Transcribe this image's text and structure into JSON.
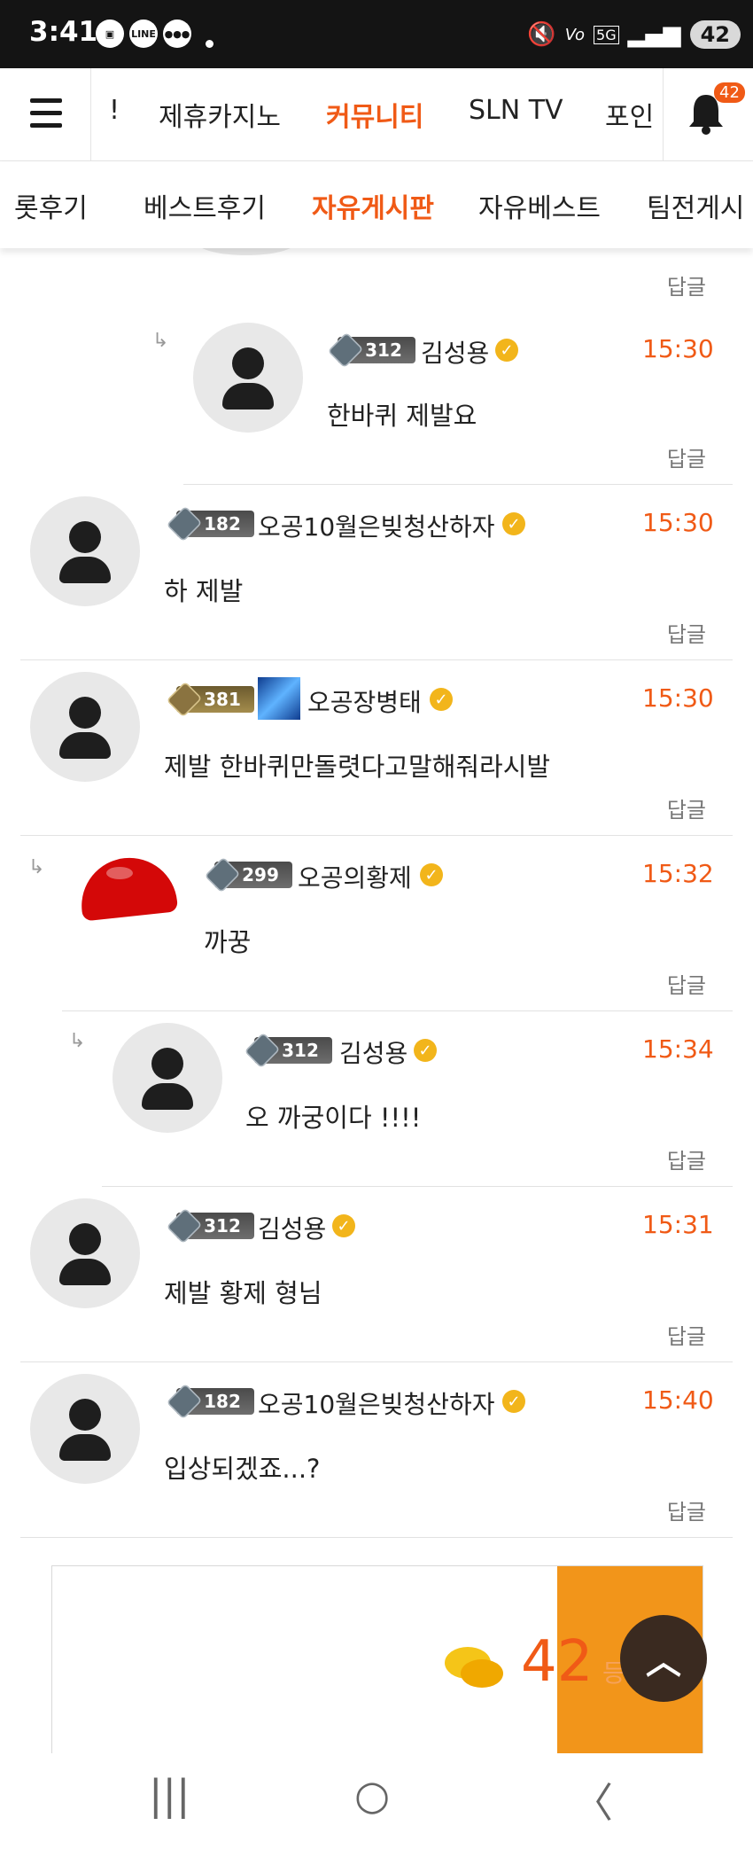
{
  "status_bar": {
    "time": "3:41",
    "battery": "42",
    "network": "5G"
  },
  "top_nav": {
    "items": [
      "!",
      "제휴카지노",
      "커뮤니티",
      "SLN TV",
      "포인"
    ],
    "active": "커뮤니티",
    "notification_count": "42"
  },
  "sub_nav": {
    "items": [
      "롯후기",
      "베스트후기",
      "자유게시판",
      "자유베스트",
      "팀전게시"
    ],
    "active": "자유게시판"
  },
  "comments": [
    {
      "level": "312",
      "name": "김성용",
      "time": "15:30",
      "text": "한바퀴 제발요",
      "reply": "답글"
    },
    {
      "level": "182",
      "name": "오공10월은빚청산하자",
      "time": "15:30",
      "text": "하 제발",
      "reply": "답글"
    },
    {
      "level": "381",
      "name": "오공장병태",
      "time": "15:30",
      "text": "제발 한바퀴만돌렷다고말해줘라시발",
      "reply": "답글"
    },
    {
      "level": "299",
      "name": "오공의황제",
      "time": "15:32",
      "text": "까꿍",
      "reply": "답글"
    },
    {
      "level": "312",
      "name": "김성용",
      "time": "15:34",
      "text": "오 까궁이다 !!!!",
      "reply": "답글"
    },
    {
      "level": "312",
      "name": "김성용",
      "time": "15:31",
      "text": "제발 황제 형님",
      "reply": "답글"
    },
    {
      "level": "182",
      "name": "오공10월은빚청산하자",
      "time": "15:40",
      "text": "입상되겠죠...?",
      "reply": "답글"
    }
  ],
  "top_reply_label": "답글",
  "floating": {
    "comment_count": "42",
    "register_label": "등록"
  },
  "colors": {
    "accent": "#f05a16",
    "status_bar": "#141414",
    "verified": "#f2b51b"
  }
}
